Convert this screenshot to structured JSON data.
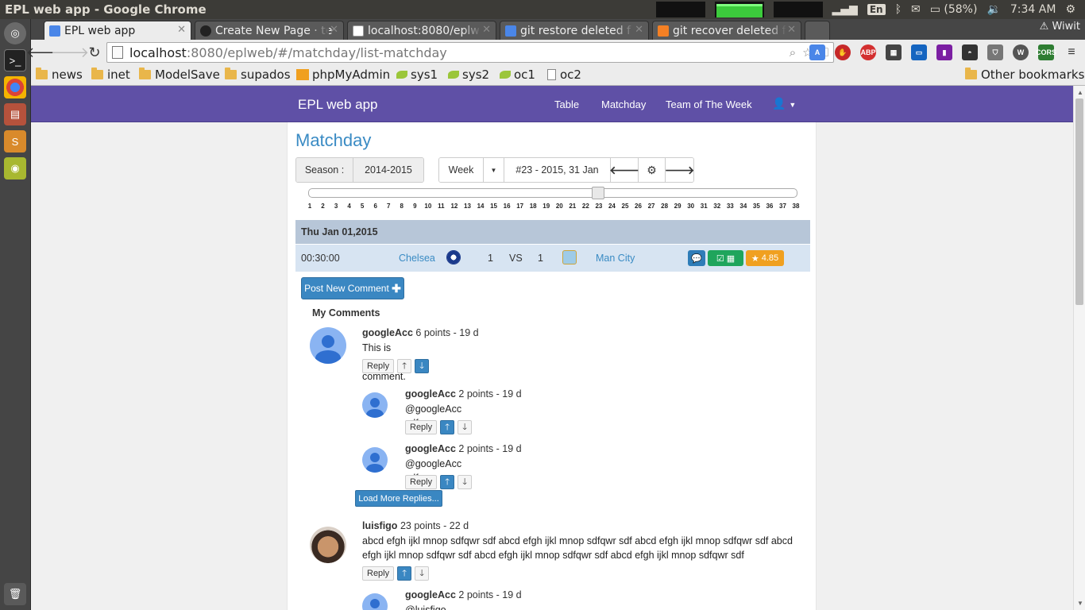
{
  "os": {
    "window_title": "EPL web app - Google Chrome",
    "keyboard": "En",
    "battery": "(58%)",
    "time": "7:34 AM"
  },
  "browser": {
    "tabs": [
      {
        "label": "EPL web app"
      },
      {
        "label": "Create New Page · te"
      },
      {
        "label": "localhost:8080/eplw"
      },
      {
        "label": "git restore deleted f"
      },
      {
        "label": "git recover deleted f"
      }
    ],
    "profile": "Wiwit",
    "url_host": "localhost",
    "url_rest": ":8080/eplweb/#/matchday/list-matchday",
    "bookmarks": [
      "news",
      "inet",
      "ModelSave",
      "supados",
      "phpMyAdmin",
      "sys1",
      "sys2",
      "oc1",
      "oc2"
    ],
    "other_bookmarks": "Other bookmarks"
  },
  "app": {
    "brand": "EPL web app",
    "nav": [
      "Table",
      "Matchday",
      "Team of The Week"
    ],
    "page_title": "Matchday",
    "season_label": "Season :",
    "season_value": "2014-2015",
    "period_label": "Week",
    "period_value": "#23 - 2015, 31 Jan",
    "slider": {
      "min": 1,
      "max": 38,
      "current": 23
    },
    "week_ticks": [
      "1",
      "2",
      "3",
      "4",
      "5",
      "6",
      "7",
      "8",
      "9",
      "10",
      "11",
      "12",
      "13",
      "14",
      "15",
      "16",
      "17",
      "18",
      "19",
      "20",
      "21",
      "22",
      "23",
      "24",
      "25",
      "26",
      "27",
      "28",
      "29",
      "30",
      "31",
      "32",
      "33",
      "34",
      "35",
      "36",
      "37",
      "38"
    ],
    "match_date": "Thu Jan 01,2015",
    "match": {
      "time": "00:30:00",
      "home": "Chelsea",
      "home_score": "1",
      "vs": "VS",
      "away_score": "1",
      "away": "Man City",
      "rating": "4.85"
    },
    "post_comment": "Post New Comment",
    "my_comments": "My Comments",
    "load_more": "Load More Replies...",
    "comments": [
      {
        "user": "googleAcc",
        "meta": "6 points - 19 d",
        "text": "This is my comment.",
        "reply": "Reply"
      },
      {
        "user": "googleAcc",
        "meta": "2 points - 19 d",
        "text": "@googleAcc sdf",
        "reply": "Reply"
      },
      {
        "user": "googleAcc",
        "meta": "2 points - 19 d",
        "text": "@googleAcc sdf",
        "reply": "Reply"
      },
      {
        "user": "luisfigo",
        "meta": "23 points - 22 d",
        "text": "abcd efgh ijkl mnop sdfqwr sdf abcd efgh ijkl mnop sdfqwr sdf abcd efgh ijkl mnop sdfqwr sdf abcd efgh ijkl mnop sdfqwr sdf abcd efgh ijkl mnop sdfqwr sdf abcd efgh ijkl mnop sdfqwr sdf",
        "reply": "Reply"
      },
      {
        "user": "googleAcc",
        "meta": "2 points - 19 d",
        "text": "@luisfigo ssssss",
        "reply": "Reply"
      }
    ]
  },
  "colors": {
    "navbar": "#5f50a6",
    "link": "#3a8bc4",
    "primary": "#3a87c2",
    "success": "#1fa55c",
    "warning": "#f0a020"
  }
}
